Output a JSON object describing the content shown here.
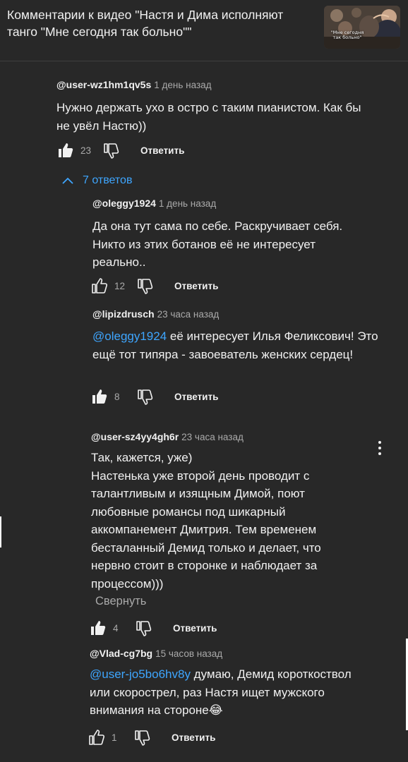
{
  "header": {
    "title": "Комментарии к видео \"Настя и Дима исполняют танго \"Мне сегодня так больно\"\"",
    "thumbnail_caption": "\"Мне сегодня так больно\""
  },
  "comments": [
    {
      "author": "@user-wz1hm1qv5s",
      "time": "1 день назад",
      "text": "Нужно держать ухо в остро с таким пианистом. Как бы не увёл Настю))",
      "likes": "23",
      "liked": true,
      "reply_label": "Ответить"
    }
  ],
  "replies_toggle": {
    "label": "7 ответов",
    "expanded": true
  },
  "replies": [
    {
      "author": "@oleggy1924",
      "time": "1 день назад",
      "mention": "",
      "text": "Да она тут сама по себе. Раскручивает себя. Никто из этих ботанов её не интересует реально..",
      "likes": "12",
      "liked": false,
      "reply_label": "Ответить"
    },
    {
      "author": "@lipizdrusch",
      "time": "23 часа назад",
      "mention": "@oleggy1924",
      "text": " её интересует Илья Феликсович! Это ещё тот типяра - завоеватель женских сердец!",
      "likes": "8",
      "liked": true,
      "reply_label": "Ответить"
    },
    {
      "author": "@user-sz4yy4gh6r",
      "time": "23 часа назад",
      "mention": "",
      "text": "Так, кажется, уже)\nНастенька уже второй день проводит с талантливым и изящным Димой, поют любовные романсы под шикарный аккомпанемент Дмитрия. Тем временем бесталанный Демид только и делает, что нервно стоит в сторонке и наблюдает за процессом)))",
      "collapse_label": "Свернуть",
      "likes": "4",
      "liked": true,
      "reply_label": "Ответить"
    },
    {
      "author": "@Vlad-cg7bg",
      "time": "15 часов назад",
      "mention": "@user-jo5bo6hv8y",
      "text": " думаю, Демид короткоствол или скорострел, раз Настя ищет мужского внимания на стороне😂",
      "likes": "1",
      "liked": false,
      "reply_label": "Ответить"
    }
  ],
  "icons": {
    "like": "thumbs-up-icon",
    "dislike": "thumbs-down-icon",
    "chevron": "chevron-up-icon",
    "more": "more-vertical-icon"
  },
  "colors": {
    "background": "#282828",
    "text": "#f1f1f1",
    "secondary_text": "#aaaaaa",
    "link": "#3ea6ff"
  }
}
